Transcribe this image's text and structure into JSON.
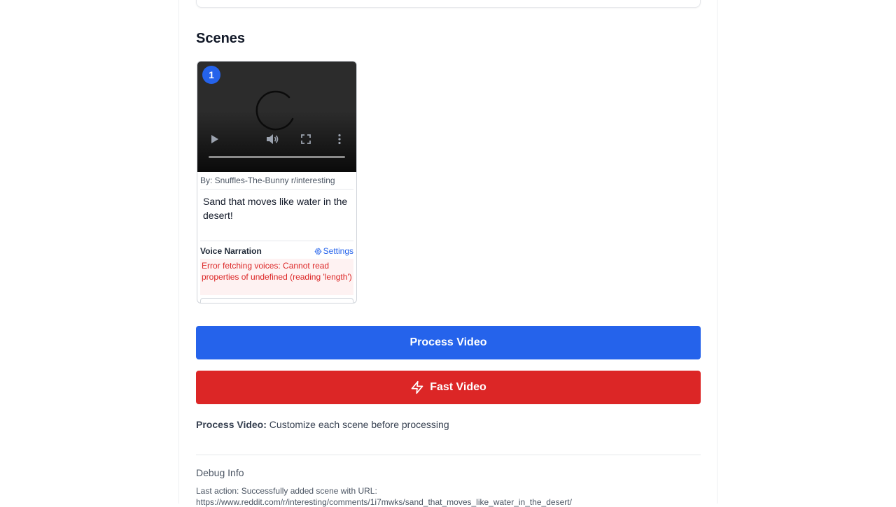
{
  "section": {
    "title": "Scenes"
  },
  "scene": {
    "badge": "1",
    "author": "By: Snuffles-The-Bunny r/interesting",
    "caption": "Sand that moves like water in the desert!",
    "voice_label": "Voice Narration",
    "settings_label": "Settings",
    "error": "Error fetching voices: Cannot read properties of undefined (reading 'length')"
  },
  "buttons": {
    "process": "Process Video",
    "fast": "Fast Video"
  },
  "hint": {
    "bold": "Process Video:",
    "text": " Customize each scene before processing"
  },
  "debug": {
    "title": "Debug Info",
    "last_action": "Last action: Successfully added scene with URL:",
    "url": "https://www.reddit.com/r/interesting/comments/1i7mwks/sand_that_moves_like_water_in_the_desert/"
  },
  "colors": {
    "primary": "#2563eb",
    "danger": "#dc2626",
    "error_bg": "#fef2f2"
  }
}
